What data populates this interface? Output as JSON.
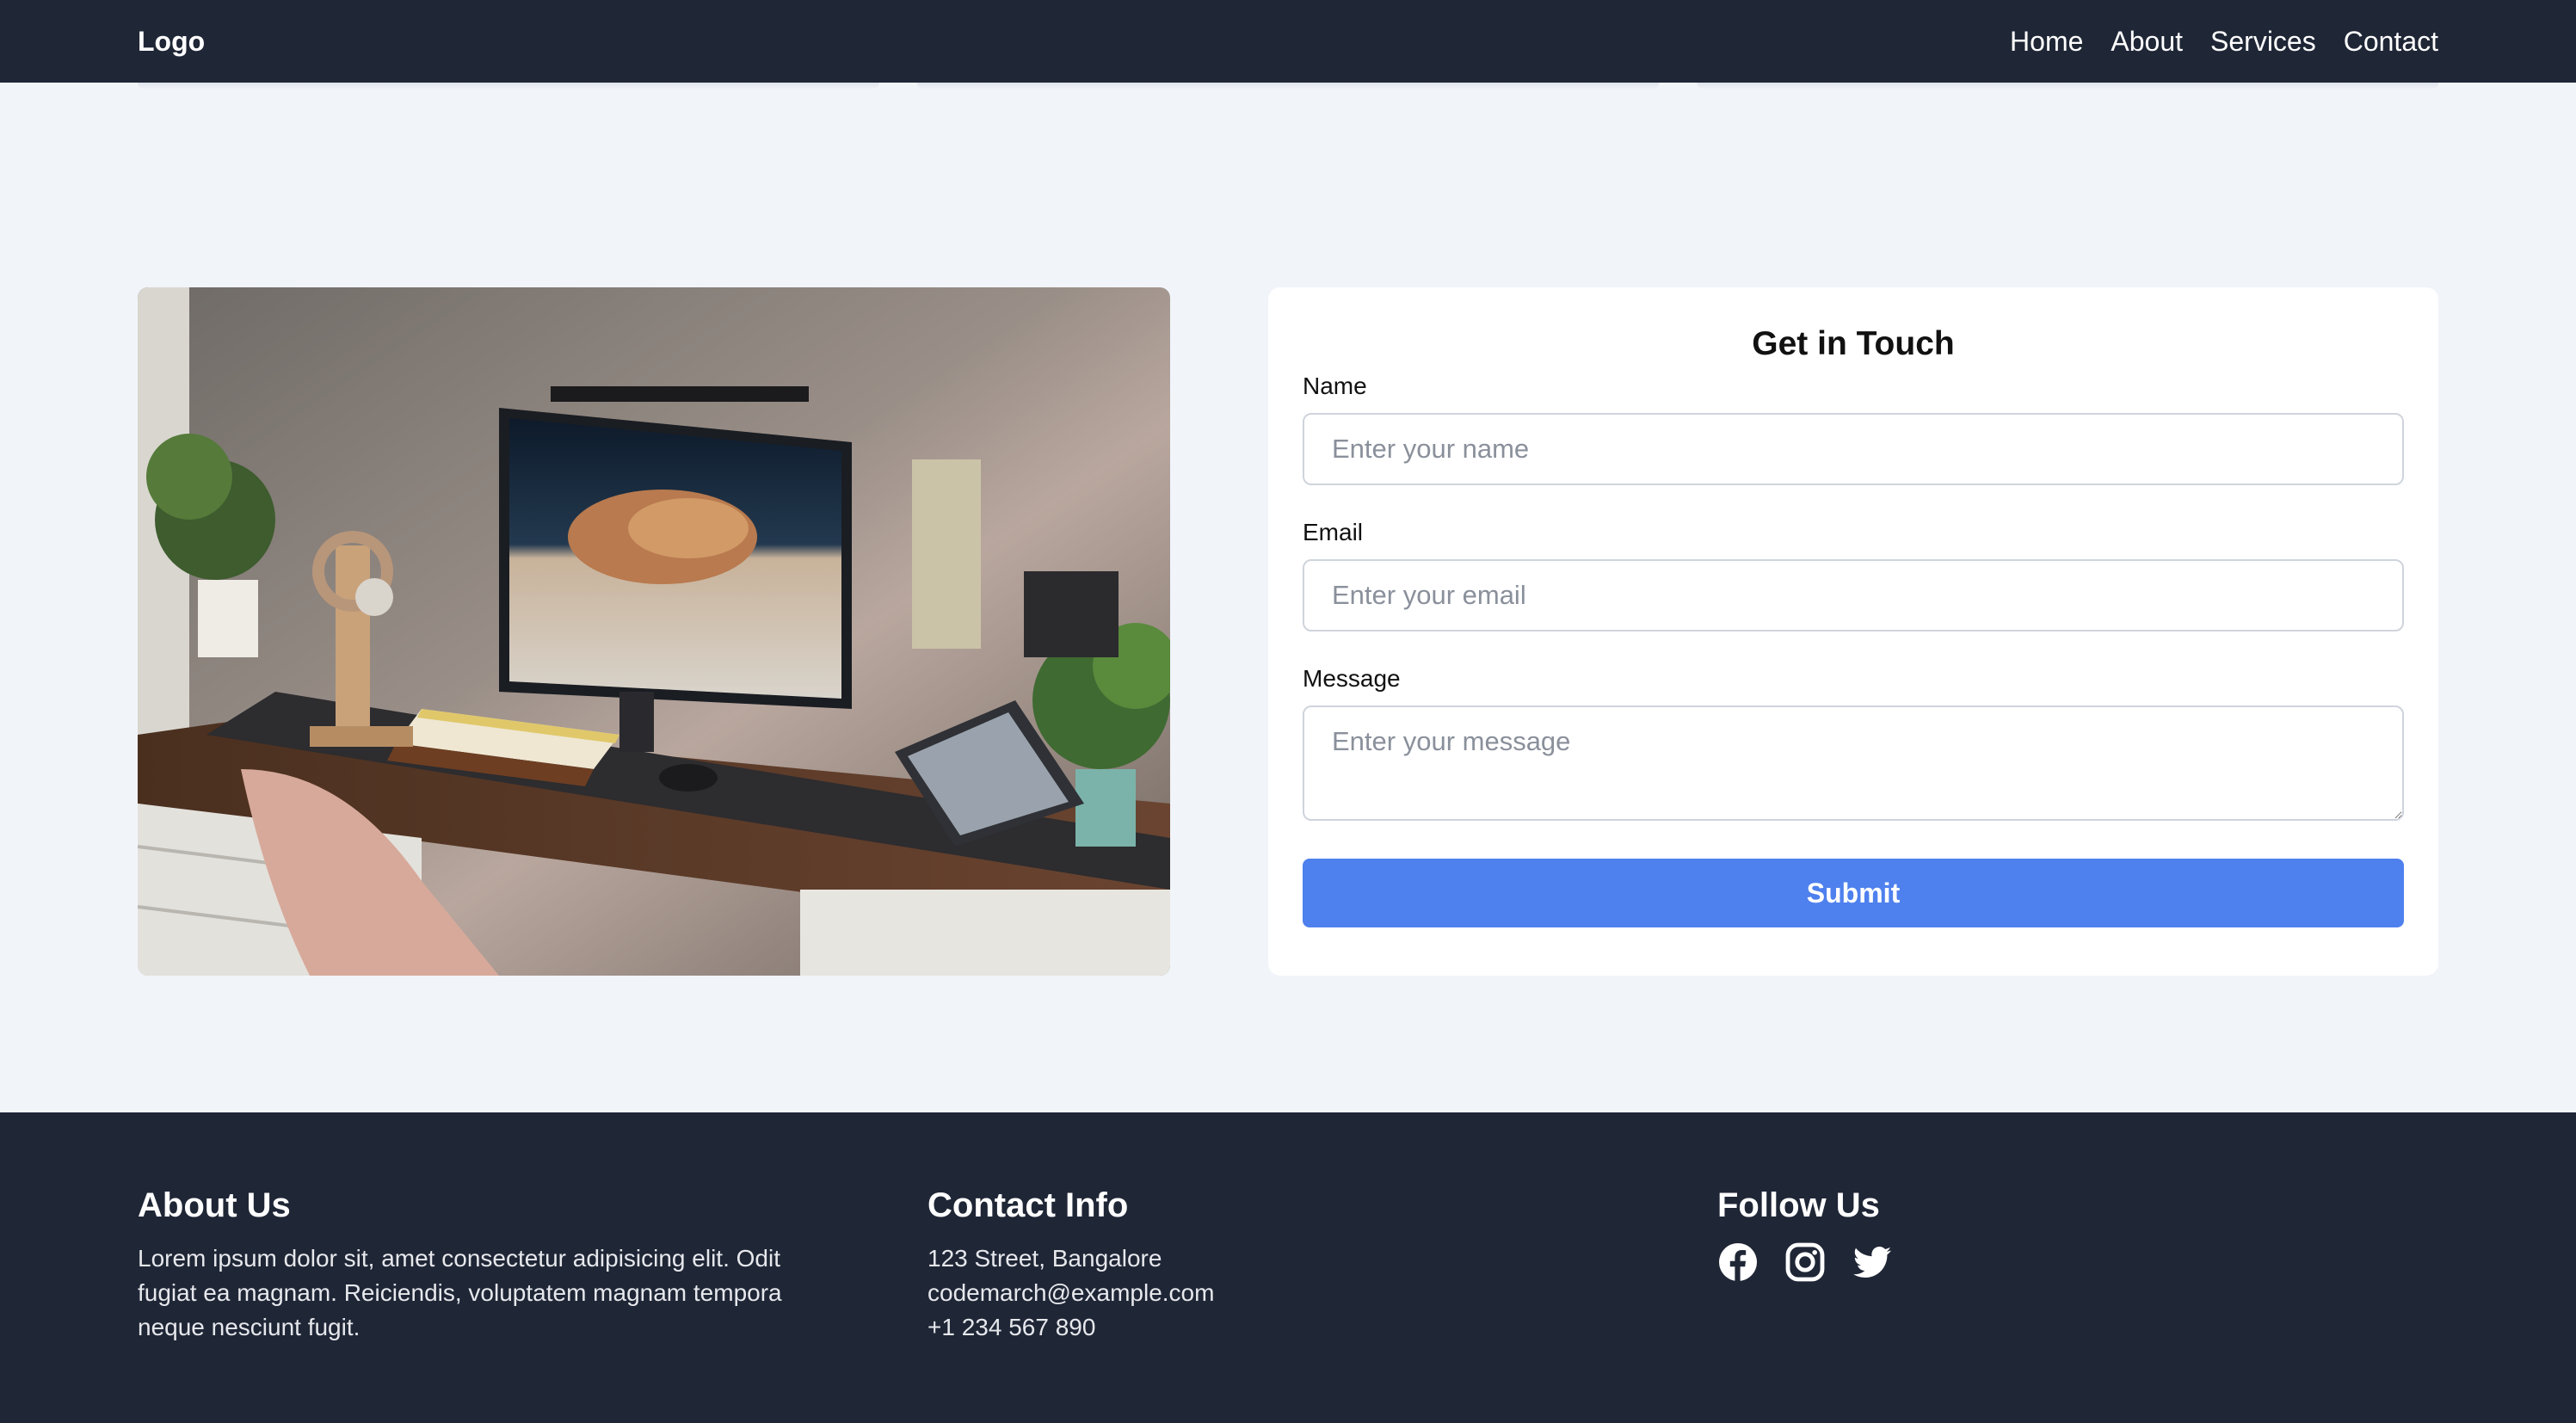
{
  "header": {
    "logo": "Logo",
    "nav": [
      "Home",
      "About",
      "Services",
      "Contact"
    ]
  },
  "hero_image": {
    "description_icon": "desk-setup-photo-image"
  },
  "contact_form": {
    "title": "Get in Touch",
    "name_label": "Name",
    "name_placeholder": "Enter your name",
    "name_value": "",
    "email_label": "Email",
    "email_placeholder": "Enter your email",
    "email_value": "",
    "message_label": "Message",
    "message_placeholder": "Enter your message",
    "message_value": "",
    "submit_label": "Submit"
  },
  "footer": {
    "about": {
      "heading": "About Us",
      "text": "Lorem ipsum dolor sit, amet consectetur adipisicing elit. Odit fugiat ea magnam. Reiciendis, voluptatem magnam tempora neque nesciunt fugit."
    },
    "contact": {
      "heading": "Contact Info",
      "address": "123 Street, Bangalore",
      "email": "codemarch@example.com",
      "phone": "+1 234 567 890"
    },
    "follow": {
      "heading": "Follow Us",
      "icons": [
        "facebook-icon",
        "instagram-icon",
        "twitter-icon"
      ]
    }
  },
  "colors": {
    "header_bg": "#1f2636",
    "page_bg": "#f1f4f9",
    "accent": "#4e80ee",
    "card_bg": "#ffffff"
  }
}
